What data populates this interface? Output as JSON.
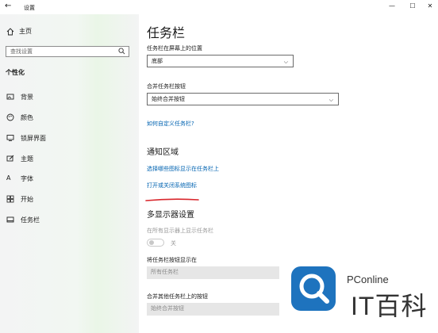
{
  "window": {
    "title": "设置",
    "back_icon": "back-arrow-icon",
    "controls": [
      "minimize",
      "maximize",
      "close"
    ]
  },
  "sidebar": {
    "home": {
      "label": "主页",
      "icon": "home-icon"
    },
    "search": {
      "placeholder": "查找设置",
      "icon": "search-icon"
    },
    "section": "个性化",
    "items": [
      {
        "label": "背景",
        "icon": "picture-icon"
      },
      {
        "label": "颜色",
        "icon": "palette-icon"
      },
      {
        "label": "锁屏界面",
        "icon": "monitor-icon"
      },
      {
        "label": "主题",
        "icon": "brush-icon"
      },
      {
        "label": "字体",
        "icon": "font-icon"
      },
      {
        "label": "开始",
        "icon": "start-grid-icon"
      },
      {
        "label": "任务栏",
        "icon": "taskbar-icon"
      }
    ]
  },
  "main": {
    "title": "任务栏",
    "position_label": "任务栏在屏幕上的位置",
    "position_value": "底部",
    "combine_label": "合并任务栏按钮",
    "combine_value": "始终合并按钮",
    "customize_link": "如何自定义任务栏?",
    "notification_title": "通知区域",
    "select_icons_link": "选择哪些图标显示在任务栏上",
    "system_icons_link": "打开或关闭系统图标",
    "multi_display_title": "多显示器设置",
    "show_all_displays_label": "在所有显示器上显示任务栏",
    "toggle_state": "关",
    "show_buttons_label": "将任务栏按钮显示在",
    "show_buttons_value": "所有任务栏",
    "other_combine_label": "合并其他任务栏上的按钮",
    "other_combine_value": "始终合并按钮"
  },
  "watermark": {
    "brand": "PConline",
    "word": "IT百科"
  },
  "colors": {
    "accent_link": "#0063b1",
    "annotation_red": "#d9262c",
    "logo_blue": "#1e73be"
  }
}
